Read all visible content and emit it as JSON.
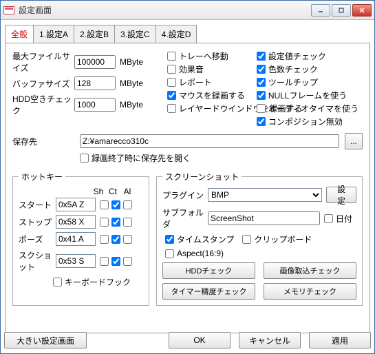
{
  "window": {
    "title": "設定画面"
  },
  "tabs": [
    "全般",
    "1.設定A",
    "2.設定B",
    "3.設定C",
    "4.設定D"
  ],
  "active_tab": 0,
  "fields": {
    "max_file_size": {
      "label": "最大ファイルサイズ",
      "value": "100000",
      "unit": "MByte"
    },
    "buffer_size": {
      "label": "バッファサイズ",
      "value": "128",
      "unit": "MByte"
    },
    "hdd_free": {
      "label": "HDD空きチェック",
      "value": "1000",
      "unit": "MByte"
    }
  },
  "chk_left": [
    {
      "label": "トレーへ移動",
      "checked": false
    },
    {
      "label": "効果音",
      "checked": false
    },
    {
      "label": "レポート",
      "checked": false
    },
    {
      "label": "マウスを録画する",
      "checked": true
    },
    {
      "label": "レイヤードウインドウを録画する",
      "checked": false
    }
  ],
  "chk_right": [
    {
      "label": "設定値チェック",
      "checked": true
    },
    {
      "label": "色数チェック",
      "checked": true
    },
    {
      "label": "ツールチップ",
      "checked": true
    },
    {
      "label": "NULLフレームを使う",
      "checked": true
    },
    {
      "label": "オーディオタイマを使う",
      "checked": false
    },
    {
      "label": "コンポジション無効",
      "checked": true
    }
  ],
  "save": {
    "label": "保存先",
    "value": "Z:¥amarecco310c",
    "browse": "...",
    "open_after": {
      "label": "録画終了時に保存先を開く",
      "checked": false
    }
  },
  "hotkey": {
    "legend": "ホットキー",
    "headers": [
      "Sh",
      "Ct",
      "Al"
    ],
    "rows": [
      {
        "label": "スタート",
        "value": "0x5A Z",
        "sh": false,
        "ct": true,
        "al": false
      },
      {
        "label": "ストップ",
        "value": "0x58 X",
        "sh": false,
        "ct": true,
        "al": false
      },
      {
        "label": "ポーズ",
        "value": "0x41 A",
        "sh": false,
        "ct": true,
        "al": false
      },
      {
        "label": "スクショット",
        "value": "0x53 S",
        "sh": false,
        "ct": true,
        "al": false
      }
    ],
    "kbhook": {
      "label": "キーボードフック",
      "checked": false
    }
  },
  "sshot": {
    "legend": "スクリーンショット",
    "plugin": {
      "label": "プラグイン",
      "value": "BMP",
      "btn": "設定"
    },
    "subfolder": {
      "label": "サブフォルダ",
      "value": "ScreenShot",
      "date": {
        "label": "日付",
        "checked": false
      }
    },
    "timestamp": {
      "label": "タイムスタンプ",
      "checked": true
    },
    "clipboard": {
      "label": "クリップボード",
      "checked": false
    },
    "aspect": {
      "label": "Aspect(16:9)",
      "checked": false
    },
    "btns": [
      "HDDチェック",
      "画像取込チェック",
      "タイマー精度チェック",
      "メモリチェック"
    ]
  },
  "bottom": {
    "big": "大きい設定画面",
    "ok": "OK",
    "cancel": "キャンセル",
    "apply": "適用"
  }
}
